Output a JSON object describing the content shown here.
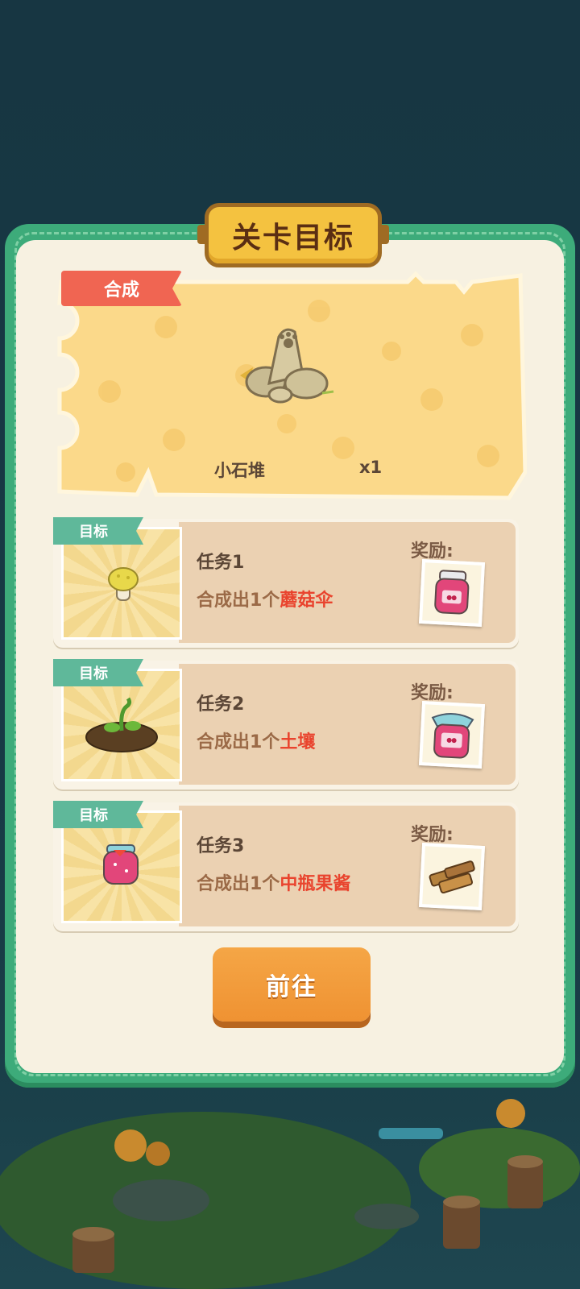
{
  "dialog": {
    "title": "关卡目标"
  },
  "main_goal": {
    "tag": "合成",
    "item_name": "小石堆",
    "count": "x1",
    "icon": "rock-pile-icon"
  },
  "tasks": [
    {
      "tag": "目标",
      "title": "任务1",
      "desc_prefix": "合成出1个",
      "desc_item": "蘑菇伞",
      "reward_label": "奖励:",
      "target_icon": "mushroom-icon",
      "reward_icon": "jam-jar-icon"
    },
    {
      "tag": "目标",
      "title": "任务2",
      "desc_prefix": "合成出1个",
      "desc_item": "土壤",
      "reward_label": "奖励:",
      "target_icon": "soil-sprout-icon",
      "reward_icon": "medium-jam-jar-icon"
    },
    {
      "tag": "目标",
      "title": "任务3",
      "desc_prefix": "合成出1个",
      "desc_item": "中瓶果酱",
      "reward_label": "奖励:",
      "target_icon": "jam-bottle-icon",
      "reward_icon": "wood-planks-icon"
    }
  ],
  "go_button": {
    "label": "前往"
  },
  "colors": {
    "frame_green": "#3dab7a",
    "title_yellow": "#f4c240",
    "ribbon_red": "#f06552",
    "tag_teal": "#5fb89a",
    "button_orange": "#ef9232",
    "highlight_red": "#e9442e"
  }
}
